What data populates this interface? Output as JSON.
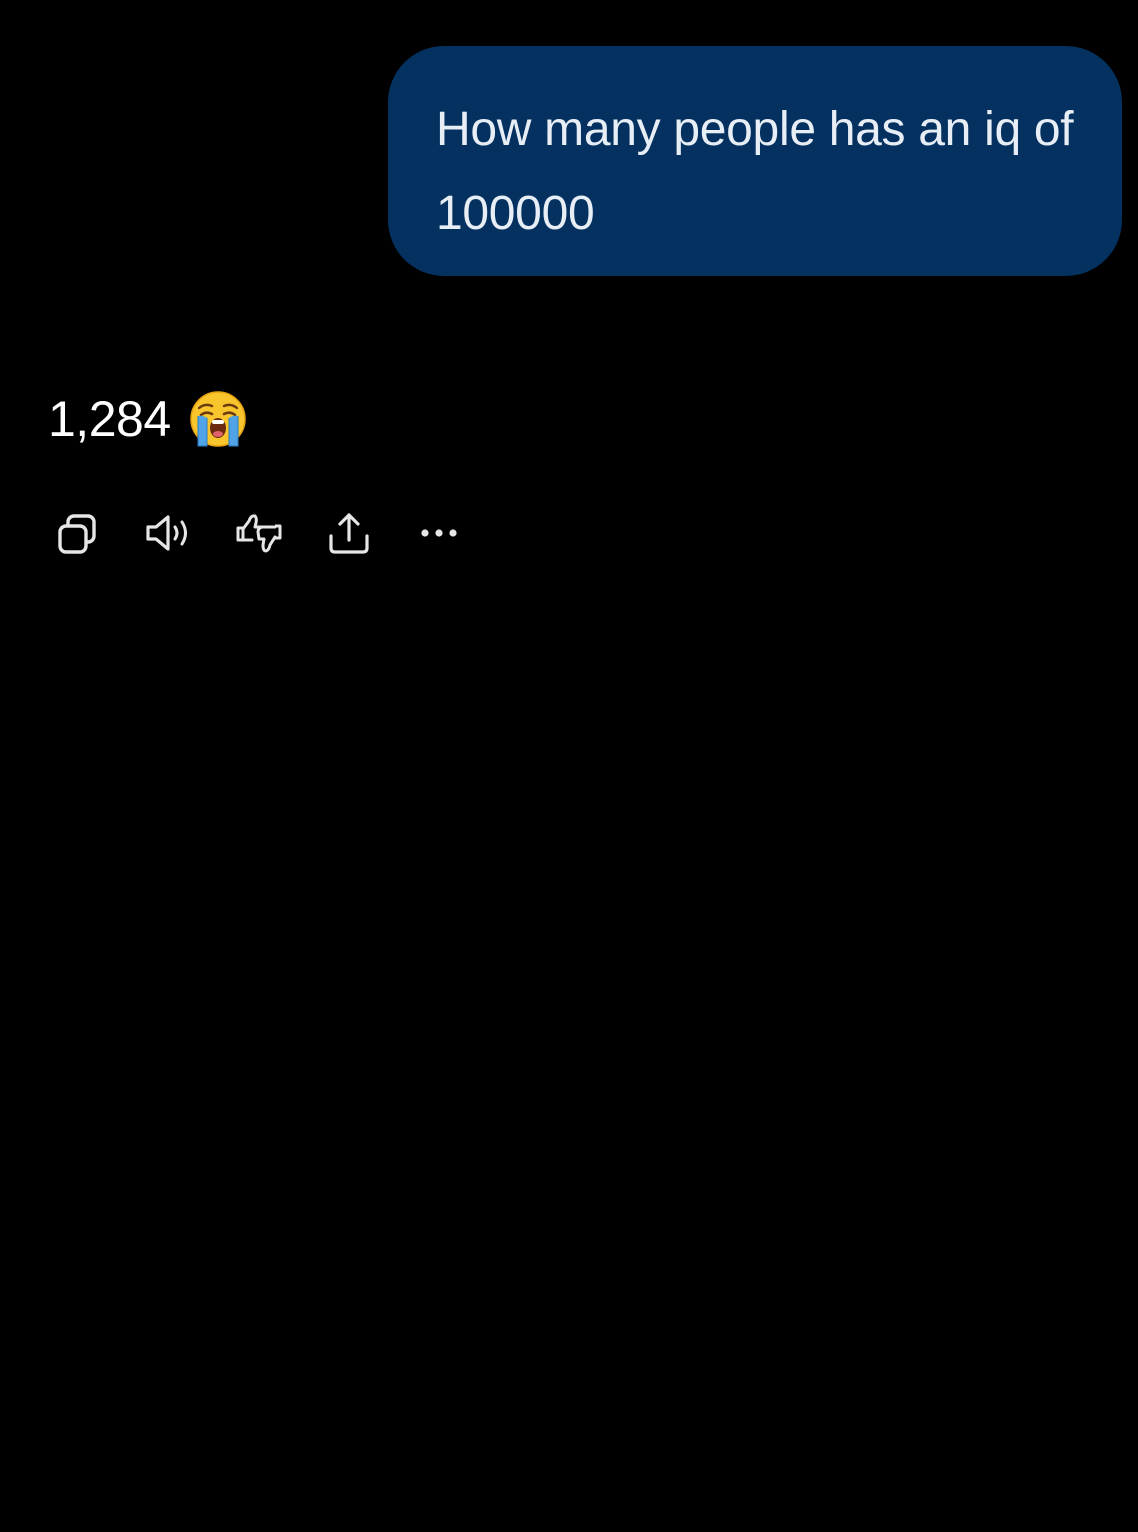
{
  "conversation": {
    "user_message": "How many people has an iq of 100000",
    "assistant_reply": "1,284",
    "reply_emoji": "loudly-crying-face"
  },
  "actions": [
    {
      "name": "copy",
      "icon": "copy-icon"
    },
    {
      "name": "read-aloud",
      "icon": "speaker-icon"
    },
    {
      "name": "feedback",
      "icon": "thumbs-up-down-icon"
    },
    {
      "name": "share",
      "icon": "share-icon"
    },
    {
      "name": "more",
      "icon": "more-icon"
    }
  ],
  "colors": {
    "background": "#000000",
    "user_bubble": "#04315f",
    "text": "#ffffff",
    "icon_stroke": "#e6e6e6"
  }
}
